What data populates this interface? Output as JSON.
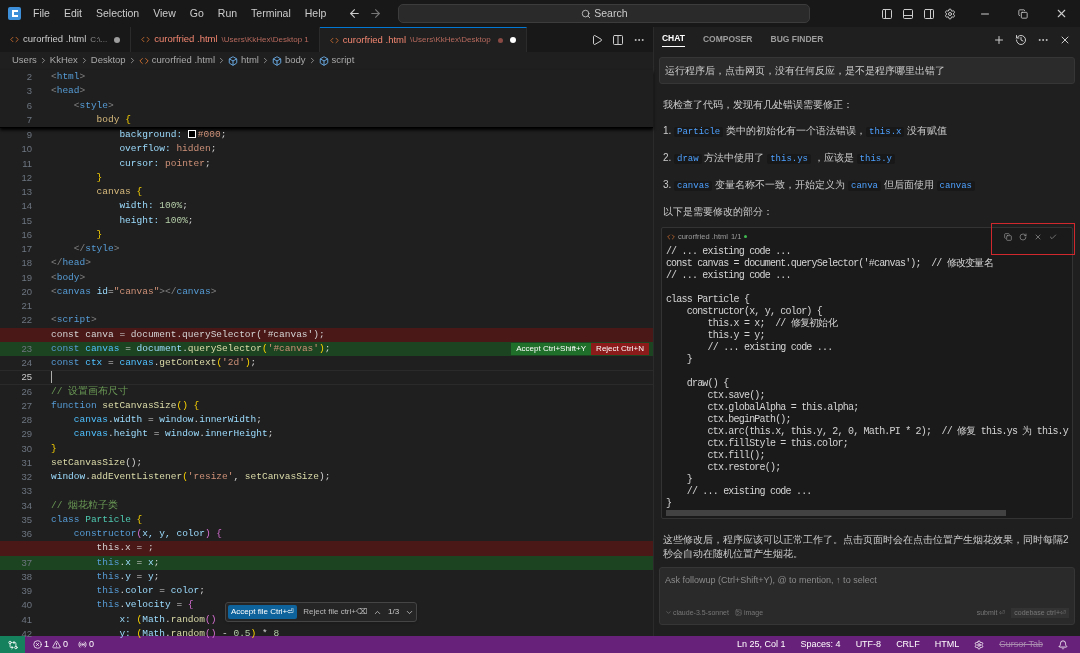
{
  "menu": [
    "File",
    "Edit",
    "Selection",
    "View",
    "Go",
    "Run",
    "Terminal",
    "Help"
  ],
  "search": {
    "label": "Search"
  },
  "tabs": [
    {
      "label": "curorfried .html",
      "path": "C:\\...",
      "error": false,
      "problem_dot": false,
      "modified": true,
      "selected": false
    },
    {
      "label": "curorfried .html",
      "path": "\\Users\\KkHex\\Desktop 1",
      "error": true,
      "problem_dot": false,
      "modified": false,
      "selected": false
    },
    {
      "label": "curorfried .html",
      "path": "\\Users\\KkHex\\Desktop",
      "error": true,
      "problem_dot": true,
      "modified": true,
      "selected": true
    }
  ],
  "breadcrumbs": [
    {
      "kind": "folder",
      "label": "Users"
    },
    {
      "kind": "folder",
      "label": "KkHex"
    },
    {
      "kind": "folder",
      "label": "Desktop"
    },
    {
      "kind": "file",
      "label": "curorfried .html"
    },
    {
      "kind": "symbol",
      "label": "html"
    },
    {
      "kind": "symbol",
      "label": "body"
    },
    {
      "kind": "symbol",
      "label": "script"
    }
  ],
  "editor": {
    "sticky": [
      {
        "n": "2",
        "seg": [
          {
            "text": "<",
            "kind": "p"
          },
          {
            "text": "html",
            "kind": "tag"
          },
          {
            "text": ">",
            "kind": "p"
          }
        ]
      },
      {
        "n": "3",
        "seg": [
          {
            "text": "<",
            "kind": "p"
          },
          {
            "text": "head",
            "kind": "tag"
          },
          {
            "text": ">",
            "kind": "p"
          }
        ]
      },
      {
        "n": "6",
        "seg": [
          {
            "text": "    <",
            "kind": "p"
          },
          {
            "text": "style",
            "kind": "tag"
          },
          {
            "text": ">",
            "kind": "p"
          }
        ]
      },
      {
        "n": "7",
        "seg": [
          {
            "text": "        body ",
            "kind": "sel"
          },
          {
            "text": "{",
            "kind": "br"
          }
        ]
      }
    ],
    "lines": [
      {
        "n": "9",
        "seg": [
          {
            "text": "            background: ",
            "kind": "prop"
          },
          {
            "text": "#000",
            "kind": "swatch"
          },
          {
            "text": ";",
            "kind": "t"
          }
        ]
      },
      {
        "n": "10",
        "seg": [
          {
            "text": "            overflow: ",
            "kind": "prop"
          },
          {
            "text": "hidden",
            "kind": "val"
          },
          {
            "text": ";",
            "kind": "t"
          }
        ]
      },
      {
        "n": "11",
        "seg": [
          {
            "text": "            cursor: ",
            "kind": "prop"
          },
          {
            "text": "pointer",
            "kind": "val"
          },
          {
            "text": ";",
            "kind": "t"
          }
        ]
      },
      {
        "n": "12",
        "seg": [
          {
            "text": "        }",
            "kind": "br"
          }
        ]
      },
      {
        "n": "13",
        "seg": [
          {
            "text": "        canvas ",
            "kind": "sel"
          },
          {
            "text": "{",
            "kind": "br"
          }
        ]
      },
      {
        "n": "14",
        "seg": [
          {
            "text": "            width: ",
            "kind": "prop"
          },
          {
            "text": "100%",
            "kind": "num"
          },
          {
            "text": ";",
            "kind": "t"
          }
        ]
      },
      {
        "n": "15",
        "seg": [
          {
            "text": "            height: ",
            "kind": "prop"
          },
          {
            "text": "100%",
            "kind": "num"
          },
          {
            "text": ";",
            "kind": "t"
          }
        ]
      },
      {
        "n": "16",
        "seg": [
          {
            "text": "        }",
            "kind": "br"
          }
        ]
      },
      {
        "n": "17",
        "seg": [
          {
            "text": "    </",
            "kind": "p"
          },
          {
            "text": "style",
            "kind": "tag"
          },
          {
            "text": ">",
            "kind": "p"
          }
        ]
      },
      {
        "n": "18",
        "seg": [
          {
            "text": "</",
            "kind": "p"
          },
          {
            "text": "head",
            "kind": "tag"
          },
          {
            "text": ">",
            "kind": "p"
          }
        ]
      },
      {
        "n": "19",
        "seg": [
          {
            "text": "<",
            "kind": "p"
          },
          {
            "text": "body",
            "kind": "tag"
          },
          {
            "text": ">",
            "kind": "p"
          }
        ]
      },
      {
        "n": "20",
        "seg": [
          {
            "text": "<",
            "kind": "p"
          },
          {
            "text": "canvas ",
            "kind": "tag"
          },
          {
            "text": "id",
            "kind": "prop"
          },
          {
            "text": "=",
            "kind": "t"
          },
          {
            "text": "\"canvas\"",
            "kind": "str"
          },
          {
            "text": "></",
            "kind": "p"
          },
          {
            "text": "canvas",
            "kind": "tag"
          },
          {
            "text": ">",
            "kind": "p"
          }
        ]
      },
      {
        "n": "21"
      },
      {
        "n": "22",
        "seg": [
          {
            "text": "<",
            "kind": "p"
          },
          {
            "text": "script",
            "kind": "tag"
          },
          {
            "text": ">",
            "kind": "p"
          }
        ]
      },
      {
        "kind": "removed",
        "seg": [
          {
            "text": "const canva = document.querySelector('#canvas');",
            "kind": "t"
          }
        ]
      },
      {
        "n": "23",
        "kind": "added",
        "seg": [
          {
            "text": "const ",
            "kind": "kw"
          },
          {
            "text": "canvas",
            "kind": "var"
          },
          {
            "text": " = ",
            "kind": "t"
          },
          {
            "text": "document",
            "kind": "prop"
          },
          {
            "text": ".",
            "kind": "t"
          },
          {
            "text": "querySelector",
            "kind": "fn"
          },
          {
            "text": "(",
            "kind": "br"
          },
          {
            "text": "'#canvas'",
            "kind": "str"
          },
          {
            "text": ")",
            "kind": "br"
          },
          {
            "text": ";",
            "kind": "t"
          }
        ],
        "actions": [
          {
            "kind": "accept",
            "label": "Accept",
            "shortcut": "Ctrl+Shift+Y"
          },
          {
            "kind": "reject",
            "label": "Reject",
            "shortcut": "Ctrl+N"
          }
        ]
      },
      {
        "n": "24",
        "seg": [
          {
            "text": "const ",
            "kind": "kw"
          },
          {
            "text": "ctx",
            "kind": "var"
          },
          {
            "text": " = ",
            "kind": "t"
          },
          {
            "text": "canvas",
            "kind": "var"
          },
          {
            "text": ".",
            "kind": "t"
          },
          {
            "text": "getContext",
            "kind": "fn"
          },
          {
            "text": "(",
            "kind": "br"
          },
          {
            "text": "'2d'",
            "kind": "str"
          },
          {
            "text": ")",
            "kind": "br"
          },
          {
            "text": ";",
            "kind": "t"
          }
        ]
      },
      {
        "n": "25",
        "current": true
      },
      {
        "n": "26",
        "seg": [
          {
            "text": "// 设置画布尺寸",
            "kind": "cmt"
          }
        ]
      },
      {
        "n": "27",
        "seg": [
          {
            "text": "function ",
            "kind": "kw"
          },
          {
            "text": "setCanvasSize",
            "kind": "fn"
          },
          {
            "text": "() {",
            "kind": "br"
          }
        ]
      },
      {
        "n": "28",
        "seg": [
          {
            "text": "    canvas",
            "kind": "var"
          },
          {
            "text": ".",
            "kind": "t"
          },
          {
            "text": "width",
            "kind": "prop"
          },
          {
            "text": " = ",
            "kind": "t"
          },
          {
            "text": "window",
            "kind": "prop"
          },
          {
            "text": ".",
            "kind": "t"
          },
          {
            "text": "innerWidth",
            "kind": "prop"
          },
          {
            "text": ";",
            "kind": "t"
          }
        ]
      },
      {
        "n": "29",
        "seg": [
          {
            "text": "    canvas",
            "kind": "var"
          },
          {
            "text": ".",
            "kind": "t"
          },
          {
            "text": "height",
            "kind": "prop"
          },
          {
            "text": " = ",
            "kind": "t"
          },
          {
            "text": "window",
            "kind": "prop"
          },
          {
            "text": ".",
            "kind": "t"
          },
          {
            "text": "innerHeight",
            "kind": "prop"
          },
          {
            "text": ";",
            "kind": "t"
          }
        ]
      },
      {
        "n": "30",
        "seg": [
          {
            "text": "}",
            "kind": "br"
          }
        ]
      },
      {
        "n": "31",
        "seg": [
          {
            "text": "setCanvasSize",
            "kind": "fn"
          },
          {
            "text": "();",
            "kind": "t"
          }
        ]
      },
      {
        "n": "32",
        "seg": [
          {
            "text": "window",
            "kind": "prop"
          },
          {
            "text": ".",
            "kind": "t"
          },
          {
            "text": "addEventListener",
            "kind": "fn"
          },
          {
            "text": "(",
            "kind": "br"
          },
          {
            "text": "'resize'",
            "kind": "str"
          },
          {
            "text": ", ",
            "kind": "t"
          },
          {
            "text": "setCanvasSize",
            "kind": "fn"
          },
          {
            "text": ");",
            "kind": "t"
          }
        ]
      },
      {
        "n": "33"
      },
      {
        "n": "34",
        "seg": [
          {
            "text": "// 烟花粒子类",
            "kind": "cmt"
          }
        ]
      },
      {
        "n": "35",
        "seg": [
          {
            "text": "class ",
            "kind": "kw"
          },
          {
            "text": "Particle ",
            "kind": "cls"
          },
          {
            "text": "{",
            "kind": "br"
          }
        ]
      },
      {
        "n": "36",
        "seg": [
          {
            "text": "    constructor",
            "kind": "kw"
          },
          {
            "text": "(",
            "kind": "pa"
          },
          {
            "text": "x, y, color",
            "kind": "prop"
          },
          {
            "text": ") {",
            "kind": "pa"
          }
        ]
      },
      {
        "kind": "removed",
        "seg": [
          {
            "text": "        this.x = ;",
            "kind": "t"
          }
        ]
      },
      {
        "n": "37",
        "kind": "added",
        "seg": [
          {
            "text": "        this",
            "kind": "kw"
          },
          {
            "text": ".",
            "kind": "t"
          },
          {
            "text": "x",
            "kind": "prop"
          },
          {
            "text": " = ",
            "kind": "t"
          },
          {
            "text": "x",
            "kind": "prop"
          },
          {
            "text": ";",
            "kind": "t"
          }
        ]
      },
      {
        "n": "38",
        "seg": [
          {
            "text": "        this",
            "kind": "kw"
          },
          {
            "text": ".",
            "kind": "t"
          },
          {
            "text": "y",
            "kind": "prop"
          },
          {
            "text": " = ",
            "kind": "t"
          },
          {
            "text": "y",
            "kind": "prop"
          },
          {
            "text": ";",
            "kind": "t"
          }
        ]
      },
      {
        "n": "39",
        "seg": [
          {
            "text": "        this",
            "kind": "kw"
          },
          {
            "text": ".",
            "kind": "t"
          },
          {
            "text": "color",
            "kind": "prop"
          },
          {
            "text": " = ",
            "kind": "t"
          },
          {
            "text": "color",
            "kind": "prop"
          },
          {
            "text": ";",
            "kind": "t"
          }
        ]
      },
      {
        "n": "40",
        "seg": [
          {
            "text": "        this",
            "kind": "kw"
          },
          {
            "text": ".",
            "kind": "t"
          },
          {
            "text": "velocity",
            "kind": "prop"
          },
          {
            "text": " = ",
            "kind": "t"
          },
          {
            "text": "{",
            "kind": "pa"
          }
        ]
      },
      {
        "n": "41",
        "seg": [
          {
            "text": "            x: ",
            "kind": "prop"
          },
          {
            "text": "(",
            "kind": "br"
          },
          {
            "text": "Math",
            "kind": "prop"
          },
          {
            "text": ".",
            "kind": "t"
          },
          {
            "text": "random",
            "kind": "fn"
          },
          {
            "text": "()",
            "kind": "pa"
          }
        ]
      },
      {
        "n": "42",
        "seg": [
          {
            "text": "            y: ",
            "kind": "prop"
          },
          {
            "text": "(",
            "kind": "br"
          },
          {
            "text": "Math",
            "kind": "prop"
          },
          {
            "text": ".",
            "kind": "t"
          },
          {
            "text": "random",
            "kind": "fn"
          },
          {
            "text": "()",
            "kind": "pa"
          },
          {
            "text": " - ",
            "kind": "t"
          },
          {
            "text": "0.5",
            "kind": "num"
          },
          {
            "text": ")",
            "kind": "br"
          },
          {
            "text": " * ",
            "kind": "t"
          },
          {
            "text": "8",
            "kind": "num"
          }
        ]
      }
    ]
  },
  "file_review": {
    "accept": "Accept file",
    "accept_shortcut": "Ctrl+⏎",
    "reject": "Reject file",
    "reject_shortcut": "ctrl+⌫",
    "counter": "1/3"
  },
  "chat": {
    "tabs": [
      {
        "label": "CHAT",
        "selected": true
      },
      {
        "label": "COMPOSER",
        "selected": false
      },
      {
        "label": "BUG FINDER",
        "selected": false
      }
    ],
    "user_message": "运行程序后，点击网页，没有任何反应，是不是程序哪里出错了",
    "paragraphs": [
      [
        {
          "text": "我检查了代码，发现有几处错误需要修正：",
          "kind": "text"
        }
      ],
      [
        {
          "text": "1. ",
          "kind": "text"
        },
        {
          "text": "Particle",
          "kind": "code"
        },
        {
          "text": " 类中的初始化有一个语法错误，",
          "kind": "text"
        },
        {
          "text": "this.x",
          "kind": "code"
        },
        {
          "text": " 没有赋值",
          "kind": "text"
        }
      ],
      [
        {
          "text": "2. ",
          "kind": "text"
        },
        {
          "text": "draw",
          "kind": "code"
        },
        {
          "text": " 方法中使用了 ",
          "kind": "text"
        },
        {
          "text": "this.ys",
          "kind": "code"
        },
        {
          "text": " ，应该是 ",
          "kind": "text"
        },
        {
          "text": "this.y",
          "kind": "code"
        }
      ],
      [
        {
          "text": "3. ",
          "kind": "text"
        },
        {
          "text": "canvas",
          "kind": "code"
        },
        {
          "text": " 变量名称不一致，开始定义为 ",
          "kind": "text"
        },
        {
          "text": "canva",
          "kind": "code"
        },
        {
          "text": " 但后面使用 ",
          "kind": "text"
        },
        {
          "text": "canvas",
          "kind": "code"
        }
      ],
      [
        {
          "text": "以下是需要修改的部分：",
          "kind": "text"
        }
      ]
    ],
    "code_block": {
      "file": "curorfried .html",
      "count": "1/1",
      "lines": [
        {
          "kind": "code",
          "text": "// ... existing code ..."
        },
        {
          "kind": "code",
          "text": "const canvas = document.querySelector('#canvas');  // 修改变量名"
        },
        {
          "kind": "code",
          "text": "// ... existing code ..."
        },
        {
          "kind": "blank"
        },
        {
          "kind": "code",
          "text": "class Particle {"
        },
        {
          "kind": "code",
          "text": "    constructor(x, y, color) {"
        },
        {
          "kind": "code",
          "text": "        this.x = x;  // 修复初始化"
        },
        {
          "kind": "code",
          "text": "        this.y = y;"
        },
        {
          "kind": "code",
          "text": "        // ... existing code ..."
        },
        {
          "kind": "code",
          "text": "    }"
        },
        {
          "kind": "blank"
        },
        {
          "kind": "code",
          "text": "    draw() {"
        },
        {
          "kind": "code",
          "text": "        ctx.save();"
        },
        {
          "kind": "code",
          "text": "        ctx.globalAlpha = this.alpha;"
        },
        {
          "kind": "code",
          "text": "        ctx.beginPath();"
        },
        {
          "kind": "code",
          "text": "        ctx.arc(this.x, this.y, 2, 0, Math.PI * 2);  // 修复 this.ys 为 this.y"
        },
        {
          "kind": "code",
          "text": "        ctx.fillStyle = this.color;"
        },
        {
          "kind": "code",
          "text": "        ctx.fill();"
        },
        {
          "kind": "code",
          "text": "        ctx.restore();"
        },
        {
          "kind": "code",
          "text": "    }"
        },
        {
          "kind": "code",
          "text": "    // ... existing code ..."
        },
        {
          "kind": "code",
          "text": "}"
        }
      ]
    },
    "closing": "这些修改后，程序应该可以正常工作了。点击页面时会在点击位置产生烟花效果，同时每隔2秒会自动在随机位置产生烟花。",
    "input": {
      "placeholder": "Ask followup (Ctrl+Shift+Y), @ to mention, ↑ to select",
      "model": "claude-3.5-sonnet",
      "image": "image",
      "submit": "submit ⏎",
      "codebase": "codebase ctrl+⏎"
    }
  },
  "status_bar": {
    "errors": "1",
    "warnings": "0",
    "ports": "0",
    "right": [
      {
        "label": "Ln 25, Col 1",
        "disabled": false
      },
      {
        "label": "Spaces: 4",
        "disabled": false
      },
      {
        "label": "UTF-8",
        "disabled": false
      },
      {
        "label": "CRLF",
        "disabled": false
      },
      {
        "label": "HTML",
        "disabled": false
      },
      {
        "label": "Cursor Tab",
        "disabled": true
      }
    ]
  }
}
